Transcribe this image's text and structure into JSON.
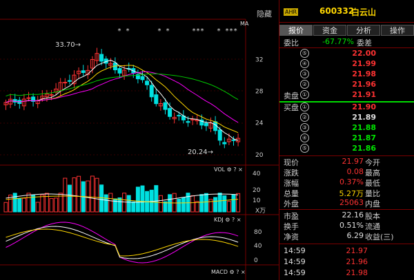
{
  "stock": {
    "market_badge": "AHR",
    "code": "600332",
    "name": "白云山"
  },
  "tabs": [
    "报价",
    "资金",
    "分析",
    "操作"
  ],
  "hide_label": "隐藏",
  "ma_label": "MA",
  "weibi": {
    "label": "委比",
    "value": "-67.77%",
    "label2": "委差"
  },
  "sell_label": "卖盘",
  "buy_label": "买盘",
  "sell_levels": [
    {
      "n": "⑤",
      "price": "22.00"
    },
    {
      "n": "④",
      "price": "21.99"
    },
    {
      "n": "③",
      "price": "21.98"
    },
    {
      "n": "②",
      "price": "21.96"
    },
    {
      "n": "①",
      "price": "21.91"
    }
  ],
  "buy_levels": [
    {
      "n": "①",
      "price": "21.90"
    },
    {
      "n": "②",
      "price": "21.89"
    },
    {
      "n": "③",
      "price": "21.88"
    },
    {
      "n": "④",
      "price": "21.87"
    },
    {
      "n": "⑤",
      "price": "21.86"
    }
  ],
  "quote": [
    {
      "l": "现价",
      "v": "21.97",
      "c": "red",
      "l2": "今开"
    },
    {
      "l": "涨跌",
      "v": "0.08",
      "c": "red",
      "l2": "最高"
    },
    {
      "l": "涨幅",
      "v": "0.37%",
      "c": "red",
      "l2": "最低"
    },
    {
      "l": "总量",
      "v": "5.27万",
      "c": "yellow",
      "l2": "量比"
    },
    {
      "l": "外盘",
      "v": "25063",
      "c": "red",
      "l2": "内盘"
    }
  ],
  "stats": [
    {
      "l": "市盈",
      "v": "22.16",
      "c": "white",
      "l2": "股本"
    },
    {
      "l": "换手",
      "v": "0.51%",
      "c": "white",
      "l2": "流通"
    },
    {
      "l": "净资",
      "v": "6.29",
      "c": "white",
      "l2": "收益(三)"
    }
  ],
  "ticks": [
    {
      "t": "14:59",
      "p": "21.97"
    },
    {
      "t": "14:59",
      "p": "21.96"
    },
    {
      "t": "14:59",
      "p": "21.98"
    }
  ],
  "chart_labels": {
    "price_axis": [
      "32",
      "28",
      "24",
      "20"
    ],
    "high_mark": "33.70",
    "low_mark": "20.24",
    "vol_title": "VOL",
    "vol_axis": [
      "40",
      "20",
      "10"
    ],
    "vol_unit": "X万",
    "kdj_title": "KDJ",
    "kdj_axis": [
      "80",
      "40",
      "0"
    ],
    "macd_title": "MACD",
    "star_marks": [
      "*  *",
      "*  *",
      "***",
      "* ***"
    ]
  },
  "colors": {
    "up": "#ff3232",
    "down": "#00e0e0",
    "ma5": "#ffffff",
    "ma10": "#ffd700",
    "ma20": "#ff00ff",
    "ma60": "#00cc00",
    "bg": "#000000",
    "grid": "#7a0000"
  }
}
